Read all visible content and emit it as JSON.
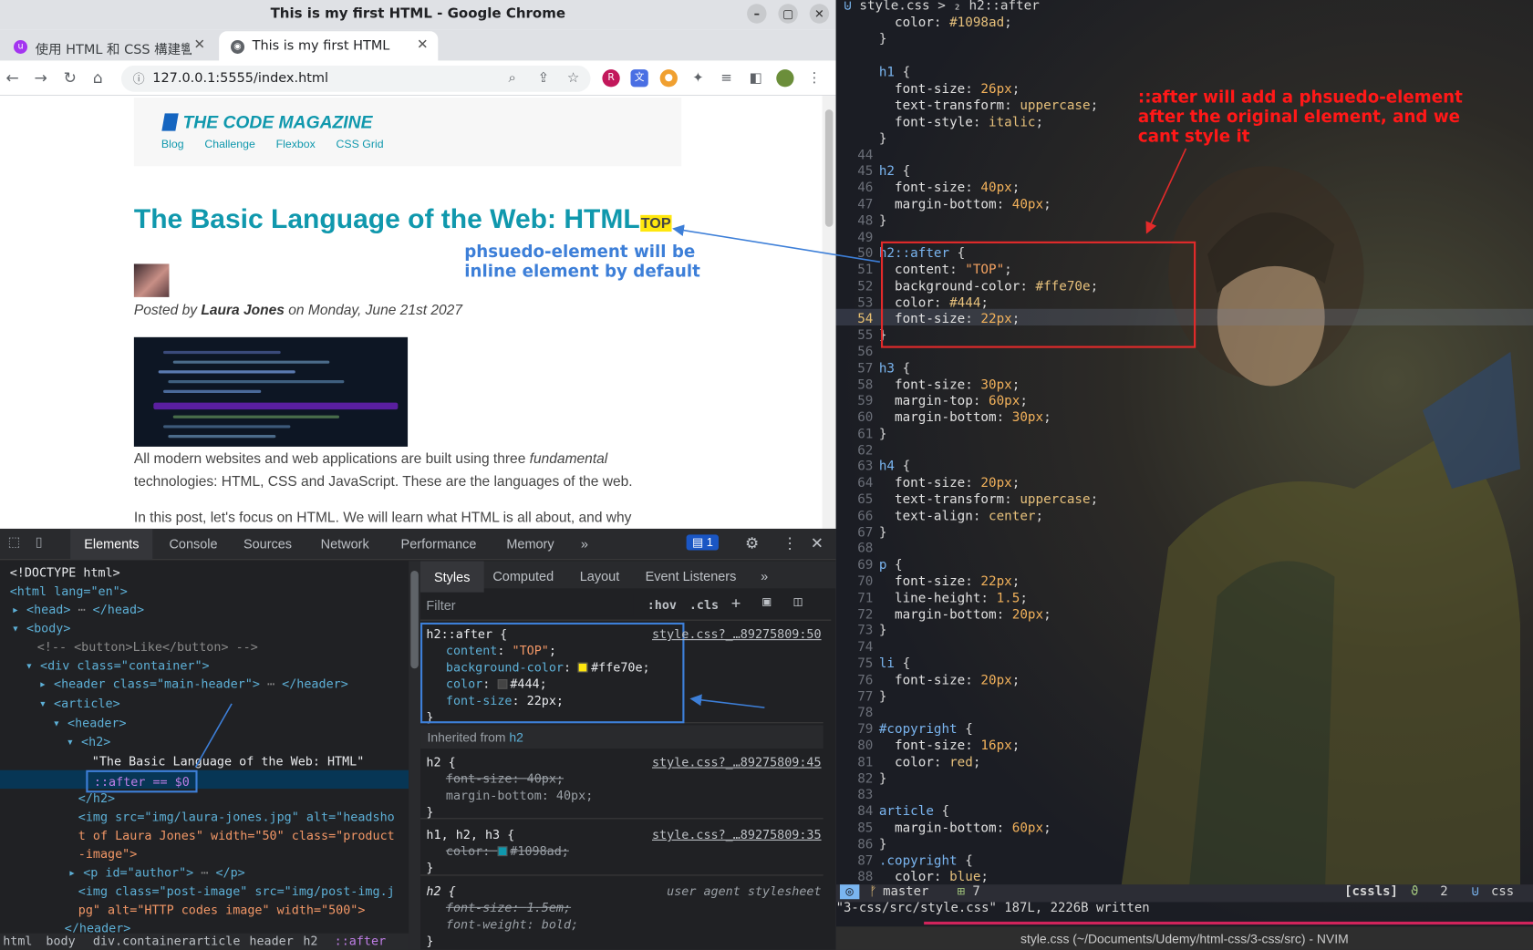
{
  "chrome": {
    "window_title": "This is my first HTML - Google Chrome",
    "tabs": [
      {
        "label": "使用 HTML 和 CSS 構建響"
      },
      {
        "label": "This is my first HTML"
      }
    ],
    "url": "127.0.0.1:5555/index.html"
  },
  "page": {
    "logo": "THE CODE MAGAZINE",
    "nav": [
      "Blog",
      "Challenge",
      "Flexbox",
      "CSS Grid"
    ],
    "heading": "The Basic Language of the Web: HTML",
    "after_text": "TOP",
    "posted_prefix": "Posted by",
    "author": "Laura Jones",
    "posted_suffix": "on Monday, June 21st 2027",
    "para1_a": "All modern websites and web applications are built using three",
    "para1_em": "fundamental",
    "para1_b": "technologies: HTML, CSS and JavaScript. These are the languages of the web.",
    "para2": "In this post, let's focus on HTML. We will learn what HTML is all about, and why"
  },
  "annotations": {
    "blue": [
      "phsuedo-element will be",
      "inline element by default"
    ],
    "red": [
      "::after will add a phsuedo-element",
      "after the original element, and we",
      "cant style it"
    ]
  },
  "devtools": {
    "tabs": [
      "Elements",
      "Console",
      "Sources",
      "Network",
      "Performance",
      "Memory"
    ],
    "issues_count": "1",
    "styles_tabs": [
      "Styles",
      "Computed",
      "Layout",
      "Event Listeners"
    ],
    "filter_placeholder": "Filter",
    "hov": ":hov",
    "cls": ".cls",
    "inherited_label": "Inherited from",
    "inherited_tag": "h2",
    "breadcrumbs": [
      "html",
      "body",
      "div.container",
      "article",
      "header",
      "h2",
      "::after"
    ],
    "dom": [
      "<!DOCTYPE html>",
      "<html lang=\"en\">",
      "<head>",
      "<body>",
      "<!-- <button>Like</button> -->",
      "<div class=\"container\">",
      "<header class=\"main-header\">",
      "<article>",
      "<header>",
      "<h2>",
      "\"The Basic Language of the Web: HTML\"",
      "::after == $0",
      "</h2>",
      "<img src=\"img/laura-jones.jpg\" alt=\"headsho",
      "t of Laura Jones\" width=\"50\" class=\"product",
      "-image\">",
      "<p id=\"author\">",
      "<img class=\"post-image\" src=\"img/post-img.j",
      "pg\" alt=\"HTTP codes image\" width=\"500\">",
      "</header>"
    ],
    "rules": [
      {
        "selector": "h2::after {",
        "source": "style.css?_…89275809:50"
      },
      {
        "selector": "h2 {",
        "source": "style.css?_…89275809:45"
      },
      {
        "selector": "h1, h2, h3 {",
        "source": "style.css?_…89275809:35"
      },
      {
        "selector": "h2 {",
        "source": "user agent stylesheet"
      }
    ],
    "after_props": [
      {
        "name": "content",
        "value": "\"TOP\""
      },
      {
        "name": "background-color",
        "value": "#ffe70e"
      },
      {
        "name": "color",
        "value": "#444"
      },
      {
        "name": "font-size",
        "value": "22px"
      }
    ],
    "h2_props": [
      {
        "name": "font-size",
        "value": "40px"
      },
      {
        "name": "margin-bottom",
        "value": "40px"
      }
    ],
    "h123_props": [
      {
        "name": "color",
        "value": "#1098ad"
      }
    ],
    "ua_props": [
      {
        "name": "font-size",
        "value": "1.5em"
      },
      {
        "name": "font-weight",
        "value": "bold"
      }
    ]
  },
  "nvim": {
    "winbar": "style.css > ₂ h2::after",
    "branch": "master",
    "changes": "7",
    "lsp": "[cssls]",
    "count": "2",
    "filetype": "css",
    "cmdline": "\"3-css/src/style.css\" 187L, 2226B written",
    "title": "style.css (~/Documents/Udemy/html-css/3-css/src) - NVIM"
  },
  "colors": {
    "accent": "#1098ad",
    "after_bg": "#ffe70e",
    "annotation_blue": "#3d7fd8",
    "annotation_red": "#ff1818"
  }
}
